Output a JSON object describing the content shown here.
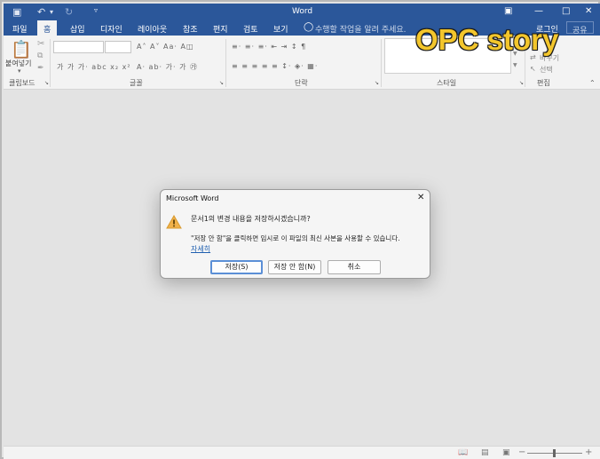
{
  "window": {
    "title": "Word",
    "min_icon": "minimize-icon",
    "max_icon": "restore-icon",
    "close_icon": "close-icon"
  },
  "quick_access": [
    "save-icon",
    "undo-icon",
    "redo-icon",
    "customize-icon"
  ],
  "tabs": [
    {
      "label": "파일"
    },
    {
      "label": "홈"
    },
    {
      "label": "삽입"
    },
    {
      "label": "디자인"
    },
    {
      "label": "레이아웃"
    },
    {
      "label": "참조"
    },
    {
      "label": "편지"
    },
    {
      "label": "검토"
    },
    {
      "label": "보기"
    }
  ],
  "tell_me": "수행할 작업을 알려 주세요.",
  "login": "로그인",
  "share": "공유",
  "ribbon": {
    "paste": "붙여넣기",
    "groups": {
      "clipboard": "클립보드",
      "font": "글꼴",
      "paragraph": "단락",
      "styles": "스타일",
      "editing": "편집"
    },
    "replace": "바꾸기",
    "select": "선택"
  },
  "watermark": "OPC story",
  "dialog": {
    "title": "Microsoft Word",
    "message": "문서1의 변경 내용을 저장하시겠습니까?",
    "detail": "\"저장 안 함\"을 클릭하면 임시로 이 파일의 최신 사본을 사용할 수 있습니다.",
    "link": "자세히",
    "buttons": {
      "save": "저장(S)",
      "dont_save": "저장 안 함(N)",
      "cancel": "취소"
    }
  },
  "status": {
    "zoom_minus": "−",
    "zoom_plus": "+"
  }
}
